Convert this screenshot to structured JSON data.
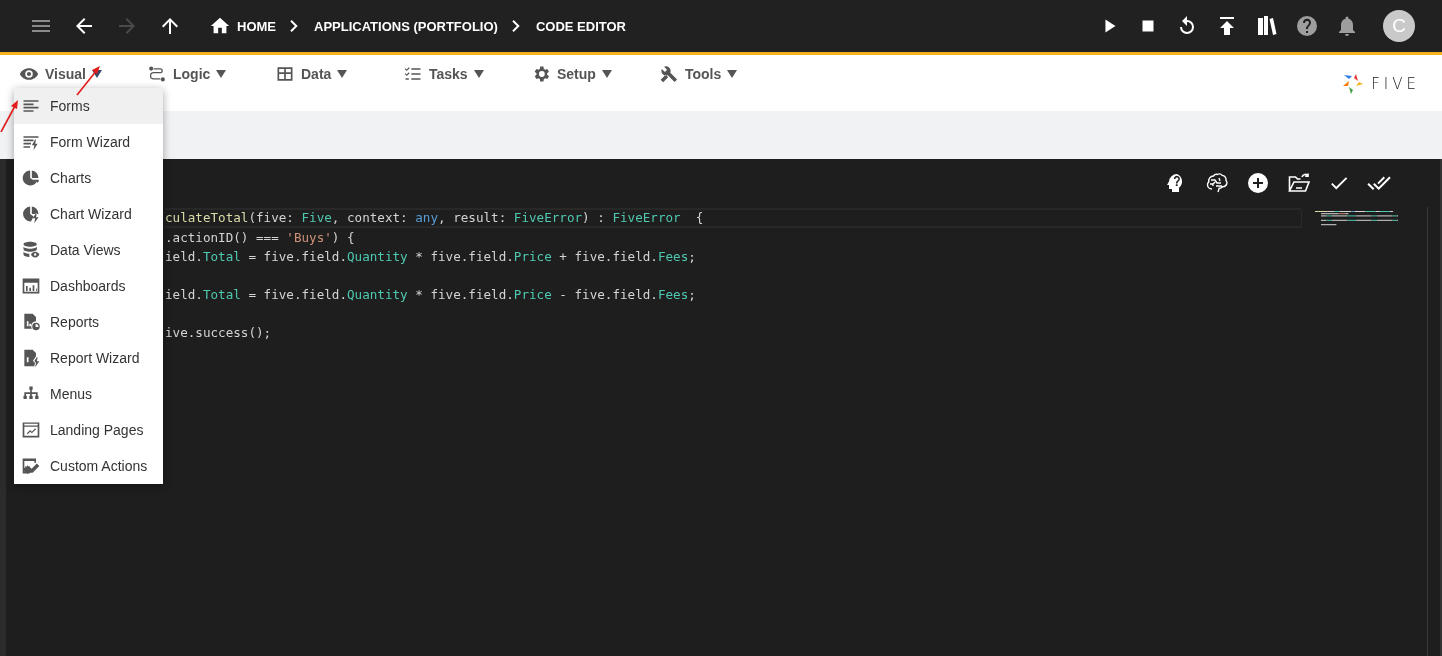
{
  "top_bar": {
    "nav": [
      {
        "kind": "menu",
        "disabled": true
      },
      {
        "kind": "back",
        "disabled": false
      },
      {
        "kind": "forward",
        "disabled": true
      },
      {
        "kind": "up",
        "disabled": false
      }
    ],
    "breadcrumbs": [
      {
        "label": "HOME",
        "kind": "home"
      },
      {
        "label": "APPLICATIONS (PORTFOLIO)",
        "kind": "plain"
      },
      {
        "label": "CODE EDITOR",
        "kind": "plain"
      }
    ],
    "actions": [
      {
        "kind": "run"
      },
      {
        "kind": "stop"
      },
      {
        "kind": "refresh"
      },
      {
        "kind": "deploy"
      },
      {
        "kind": "library"
      },
      {
        "kind": "help"
      },
      {
        "kind": "bell"
      }
    ],
    "avatar": "C"
  },
  "menu_bar": {
    "items": [
      {
        "label": "Visual",
        "kind": "eye",
        "expanded": true
      },
      {
        "label": "Logic",
        "kind": "logic",
        "expanded": false
      },
      {
        "label": "Data",
        "kind": "table",
        "expanded": false
      },
      {
        "label": "Tasks",
        "kind": "tasks",
        "expanded": false
      },
      {
        "label": "Setup",
        "kind": "gear",
        "expanded": false
      },
      {
        "label": "Tools",
        "kind": "tools",
        "expanded": false
      }
    ],
    "logo": "FIVE"
  },
  "dropdown": {
    "items": [
      {
        "label": "Forms",
        "kind": "forms",
        "selected": true
      },
      {
        "label": "Form Wizard",
        "kind": "formwizard",
        "selected": false
      },
      {
        "label": "Charts",
        "kind": "chart",
        "selected": false
      },
      {
        "label": "Chart Wizard",
        "kind": "chartwizard",
        "selected": false
      },
      {
        "label": "Data Views",
        "kind": "database",
        "selected": false
      },
      {
        "label": "Dashboards",
        "kind": "dashboard",
        "selected": false
      },
      {
        "label": "Reports",
        "kind": "report",
        "selected": false
      },
      {
        "label": "Report Wizard",
        "kind": "reportwizard",
        "selected": false
      },
      {
        "label": "Menus",
        "kind": "sitemap",
        "selected": false
      },
      {
        "label": "Landing Pages",
        "kind": "landing",
        "selected": false
      },
      {
        "label": "Custom Actions",
        "kind": "custom",
        "selected": false
      }
    ]
  },
  "editor": {
    "tools": [
      {
        "kind": "hint"
      },
      {
        "kind": "brain"
      },
      {
        "kind": "add"
      },
      {
        "kind": "open"
      },
      {
        "kind": "check"
      },
      {
        "kind": "checkall"
      }
    ],
    "lines": [
      {
        "kind": "code",
        "tokens": [
          {
            "text": "culateTotal",
            "kind": "function"
          },
          {
            "text": "(five: ",
            "kind": "plain"
          },
          {
            "text": "Five",
            "kind": "type"
          },
          {
            "text": ", context: ",
            "kind": "plain"
          },
          {
            "text": "any",
            "kind": "keyword"
          },
          {
            "text": ", result: ",
            "kind": "plain"
          },
          {
            "text": "FiveError",
            "kind": "type"
          },
          {
            "text": ") : ",
            "kind": "plain"
          },
          {
            "text": "FiveError",
            "kind": "type"
          },
          {
            "text": "  {",
            "kind": "plain"
          }
        ]
      },
      {
        "kind": "code",
        "tokens": [
          {
            "text": ".actionID() === ",
            "kind": "plain"
          },
          {
            "text": "'Buys'",
            "kind": "string"
          },
          {
            "text": ") {",
            "kind": "plain"
          }
        ]
      },
      {
        "kind": "code",
        "tokens": [
          {
            "text": "ield.",
            "kind": "plain"
          },
          {
            "text": "Total",
            "kind": "type"
          },
          {
            "text": " = five.field.",
            "kind": "plain"
          },
          {
            "text": "Quantity",
            "kind": "type"
          },
          {
            "text": " * five.field.",
            "kind": "plain"
          },
          {
            "text": "Price",
            "kind": "type"
          },
          {
            "text": " + five.field.",
            "kind": "plain"
          },
          {
            "text": "Fees",
            "kind": "type"
          },
          {
            "text": ";",
            "kind": "plain"
          }
        ]
      },
      {
        "kind": "blank"
      },
      {
        "kind": "code",
        "tokens": [
          {
            "text": "ield.",
            "kind": "plain"
          },
          {
            "text": "Total",
            "kind": "type"
          },
          {
            "text": " = five.field.",
            "kind": "plain"
          },
          {
            "text": "Quantity",
            "kind": "type"
          },
          {
            "text": " * five.field.",
            "kind": "plain"
          },
          {
            "text": "Price",
            "kind": "type"
          },
          {
            "text": " - five.field.",
            "kind": "plain"
          },
          {
            "text": "Fees",
            "kind": "type"
          },
          {
            "text": ";",
            "kind": "plain"
          }
        ]
      },
      {
        "kind": "blank"
      },
      {
        "kind": "code",
        "tokens": [
          {
            "text": "ive.success();",
            "kind": "plain"
          }
        ]
      }
    ]
  }
}
